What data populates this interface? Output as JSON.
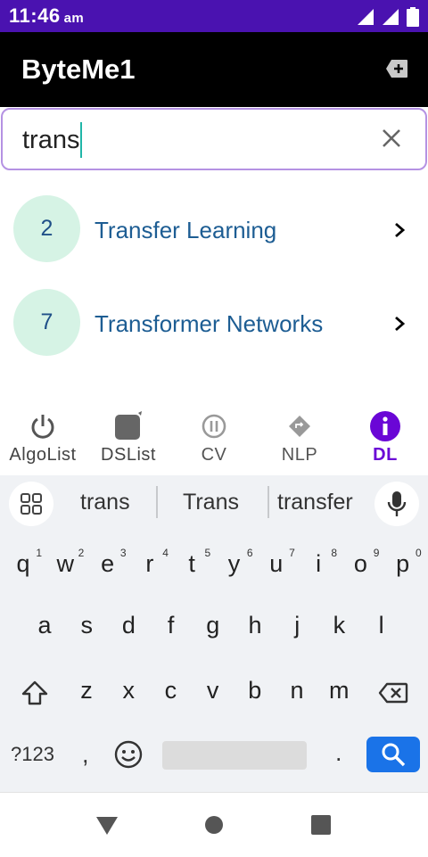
{
  "status_bar": {
    "time": "11:46",
    "ampm": "am"
  },
  "app_bar": {
    "title": "ByteMe1"
  },
  "search": {
    "value": "trans"
  },
  "results": [
    {
      "number": "2",
      "title": "Transfer Learning"
    },
    {
      "number": "7",
      "title": "Transformer Networks"
    }
  ],
  "bottom_nav": {
    "items": [
      {
        "label": "AlgoList",
        "icon": "power-icon"
      },
      {
        "label": "DSList",
        "icon": "square-icon"
      },
      {
        "label": "CV",
        "icon": "info-circle-icon"
      },
      {
        "label": "NLP",
        "icon": "diamond-icon"
      },
      {
        "label": "DL",
        "icon": "info-icon",
        "active": true
      }
    ]
  },
  "keyboard": {
    "suggestions": [
      "trans",
      "Trans",
      "transfer"
    ],
    "row1": [
      {
        "k": "q",
        "h": "1"
      },
      {
        "k": "w",
        "h": "2"
      },
      {
        "k": "e",
        "h": "3"
      },
      {
        "k": "r",
        "h": "4"
      },
      {
        "k": "t",
        "h": "5"
      },
      {
        "k": "y",
        "h": "6"
      },
      {
        "k": "u",
        "h": "7"
      },
      {
        "k": "i",
        "h": "8"
      },
      {
        "k": "o",
        "h": "9"
      },
      {
        "k": "p",
        "h": "0"
      }
    ],
    "row2": [
      "a",
      "s",
      "d",
      "f",
      "g",
      "h",
      "j",
      "k",
      "l"
    ],
    "row3": [
      "z",
      "x",
      "c",
      "v",
      "b",
      "n",
      "m"
    ],
    "symbols_key": "?123",
    "comma_key": ",",
    "period_key": "."
  },
  "colors": {
    "status_bar": "#4a12b0",
    "accent": "#6a06d6",
    "badge_bg": "#d6f3e5",
    "link_text": "#1d5d93",
    "search_key": "#1a73e8"
  }
}
